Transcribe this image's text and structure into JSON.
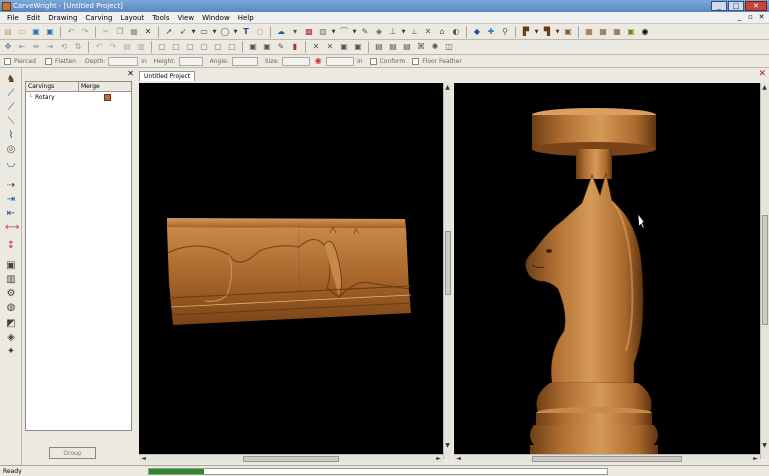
{
  "window": {
    "title": "CarveWright - [Untitled Project]",
    "min_label": "_",
    "max_label": "□",
    "close_label": "✕"
  },
  "menu": {
    "items": [
      "File",
      "Edit",
      "Drawing",
      "Carving",
      "Layout",
      "Tools",
      "View",
      "Window",
      "Help"
    ],
    "mdi_min": "_",
    "mdi_restore": "▫",
    "mdi_close": "✕"
  },
  "properties_bar": {
    "pierced": "Pierced",
    "flatten": "Flatten",
    "depth": "Depth:",
    "depth_unit": "in",
    "height": "Height:",
    "angle": "Angle:",
    "size": "Size:",
    "size_unit": "in",
    "conform": "Conform",
    "floor_feather": "Floor Feather"
  },
  "carvings_panel": {
    "close": "✕",
    "col_carvings": "Carvings",
    "col_merge": "Merge",
    "item_label": "Rotary",
    "group_button": "Group"
  },
  "document": {
    "tab_label": "Untitled Project",
    "close": "✕"
  },
  "scroll": {
    "up": "▲",
    "down": "▼",
    "left": "◄",
    "right": "►"
  },
  "status": {
    "text": "Ready",
    "progress": 0.12,
    "progress_color": "#2f8a2f"
  },
  "colors": {
    "wood": "#b9773a",
    "wood_dark": "#6e3f15",
    "viewport_bg": "#000000",
    "titlebar": "#6b96cf"
  },
  "icons": {
    "toolbar1": [
      "new-icon",
      "open-icon",
      "save-icon",
      "save-all-icon",
      "undo-icon",
      "redo-icon",
      "cut-icon",
      "copy-icon",
      "paste-icon",
      "delete-icon",
      "select-icon",
      "node-edit-icon",
      "rectangle-icon",
      "ellipse-icon",
      "text-icon",
      "curve-icon",
      "cloud-icon",
      "bit-icon",
      "pattern-icon",
      "image-icon",
      "shape-icon",
      "carving-icon",
      "layers-icon",
      "mirror-icon",
      "trace-icon",
      "hand-icon",
      "zoom-icon",
      "view3d-icon",
      "find-icon",
      "lock-icon",
      "texture-icon",
      "grid-icon",
      "layout-icon",
      "eye-icon"
    ],
    "toolbar2": [
      "move-icon",
      "align-left-icon",
      "align-center-icon",
      "align-right-icon",
      "rotate-icon",
      "flip-icon",
      "mirror-h-icon",
      "mirror-v-icon",
      "group-icon",
      "ungroup-icon",
      "fillet-icon",
      "offset-icon",
      "trim-icon",
      "extend-icon",
      "join-icon",
      "weld-icon",
      "arrange-icon",
      "distribute-icon",
      "spacing-icon",
      "center-icon",
      "stretch-icon",
      "carve-mode-icon",
      "bit-select-icon",
      "tab-icon",
      "feather-icon"
    ],
    "left_tools": [
      "chess-piece-icon",
      "ruler-icon",
      "measure-icon",
      "draw-line-icon",
      "bezier-icon",
      "circle-tool-icon",
      "arc-icon",
      "spiral-icon",
      "point-icon",
      "dimension-icon",
      "dimension-arrows-icon",
      "arrow-icon",
      "marker-icon",
      "vertical-dimension-icon",
      "cylinder-icon",
      "book-icon",
      "gear-tool-icon",
      "rounded-icon",
      "bevel-icon",
      "cube-icon",
      "sparkle-icon"
    ]
  }
}
